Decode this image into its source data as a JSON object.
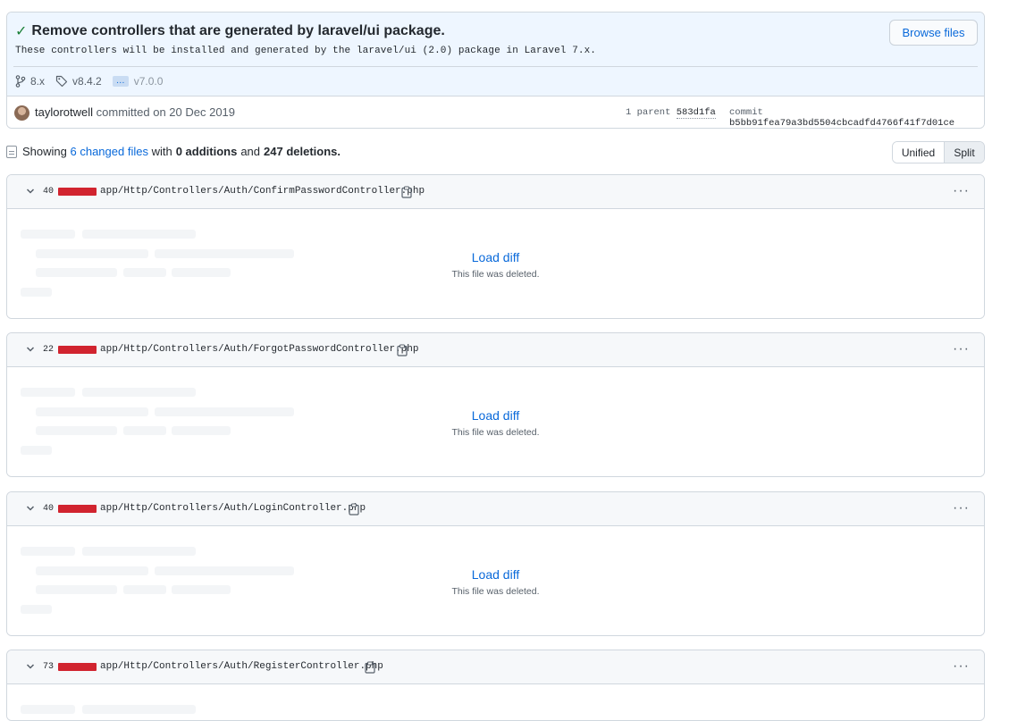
{
  "commit": {
    "title": "Remove controllers that are generated by laravel/ui package.",
    "description": "These controllers will be installed and generated by the laravel/ui (2.0) package in Laravel 7.x.",
    "browse_label": "Browse files",
    "branch": "8.x",
    "tag": "v8.4.2",
    "ellipsis": "…",
    "tag_end": "v7.0.0",
    "author": "taylorotwell",
    "committed_text": "committed on 20 Dec 2019",
    "parent_prefix": "1 parent",
    "parent_sha": "583d1fa",
    "commit_prefix": "commit",
    "commit_sha": "b5bb91fea79a3bd5504cbcadfd4766f41f7d01ce"
  },
  "summary": {
    "showing": "Showing",
    "changed_files": "6 changed files",
    "with": "with",
    "additions": "0 additions",
    "and": "and",
    "deletions": "247 deletions."
  },
  "view_toggle": {
    "unified": "Unified",
    "split": "Split",
    "selected": "Split"
  },
  "files": [
    {
      "deletions": "40",
      "path": "app/Http/Controllers/Auth/ConfirmPasswordController.php",
      "load_label": "Load diff",
      "note": "This file was deleted."
    },
    {
      "deletions": "22",
      "path": "app/Http/Controllers/Auth/ForgotPasswordController.php",
      "load_label": "Load diff",
      "note": "This file was deleted."
    },
    {
      "deletions": "40",
      "path": "app/Http/Controllers/Auth/LoginController.php",
      "load_label": "Load diff",
      "note": "This file was deleted."
    },
    {
      "deletions": "73",
      "path": "app/Http/Controllers/Auth/RegisterController.php",
      "load_label": "",
      "note": ""
    }
  ],
  "colors": {
    "accent": "#0969da",
    "deletion": "#d1242f",
    "success": "#1a7f37",
    "header_bg": "#eef6ff"
  }
}
